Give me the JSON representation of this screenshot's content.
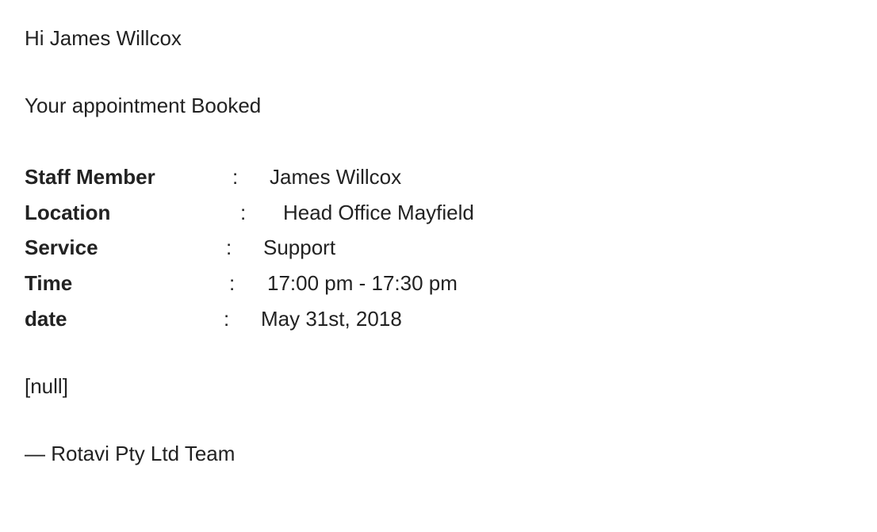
{
  "email": {
    "greeting": "Hi James Willcox",
    "intro": "Your appointment Booked",
    "details": [
      {
        "label": "Staff Member",
        "separator": ":",
        "value": "James Willcox"
      },
      {
        "label": "Location",
        "separator": ":",
        "value": "Head Office Mayfield"
      },
      {
        "label": "Service",
        "separator": ":",
        "value": "Support"
      },
      {
        "label": "Time",
        "separator": ":",
        "value": "17:00 pm - 17:30 pm"
      },
      {
        "label": "date",
        "separator": ":",
        "value": "May 31st, 2018"
      }
    ],
    "note": "[null]",
    "signature": "— Rotavi Pty Ltd Team"
  }
}
